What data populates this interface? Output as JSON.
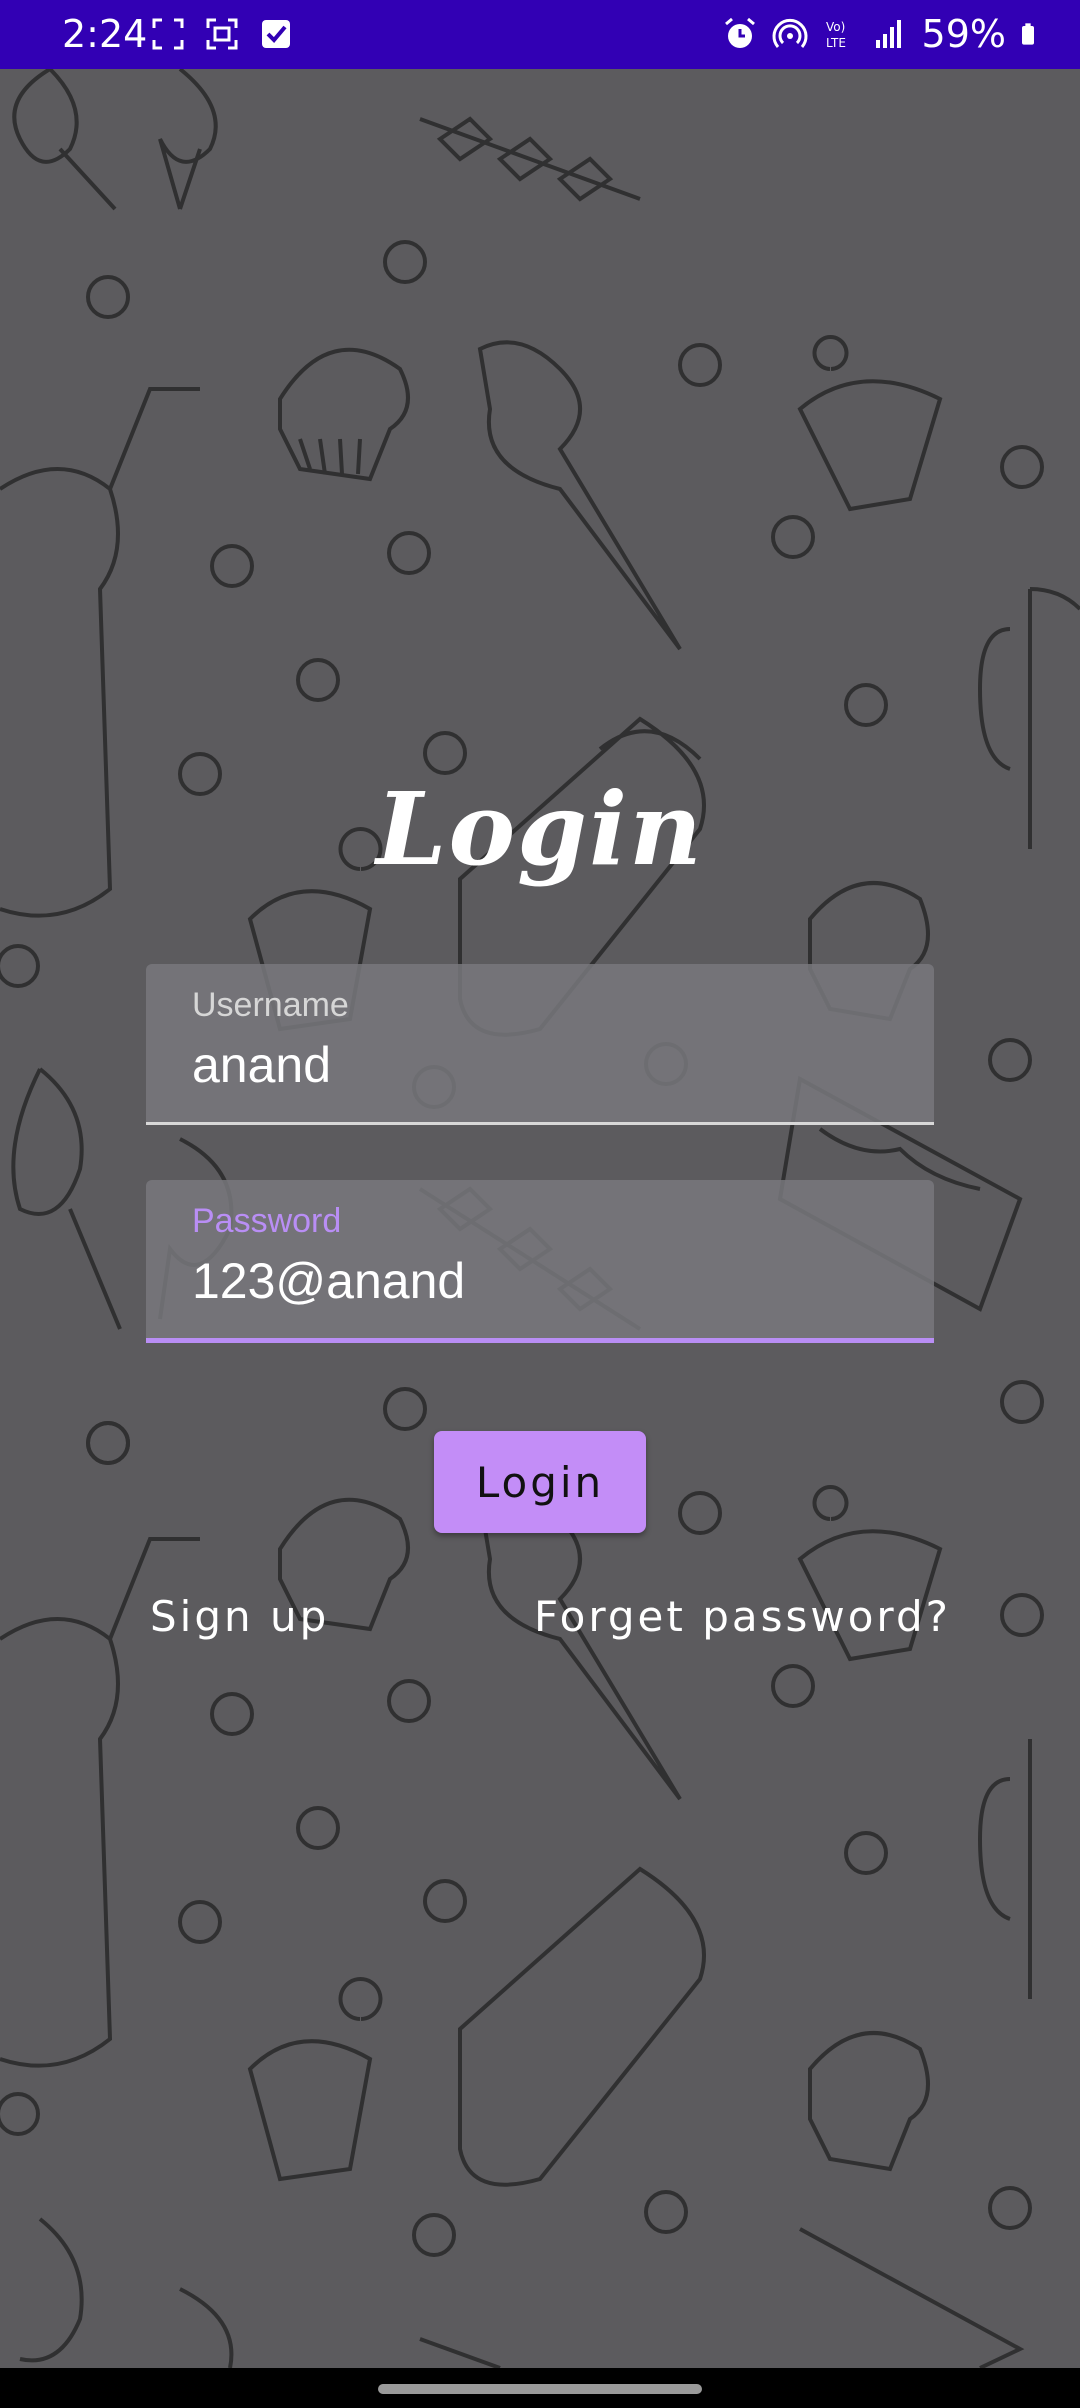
{
  "status_bar": {
    "time": "2:24",
    "battery_percent": "59%",
    "icons": [
      "screenshot-icon",
      "scan-icon",
      "checkbox-icon",
      "alarm-icon",
      "hotspot-icon",
      "volte-icon",
      "signal-icon",
      "battery-icon"
    ],
    "colors": {
      "background": "#3200b4"
    }
  },
  "screen": {
    "title": "Login",
    "username_label": "Username",
    "username_value": "anand",
    "password_label": "Password",
    "password_value": "123@anand",
    "login_button": "Login",
    "signup_link": "Sign up",
    "forget_link": "Forget password?"
  },
  "theme": {
    "accent": "#c38df7",
    "focus_underline": "#b98ef5",
    "background": "#5c5b5e"
  }
}
